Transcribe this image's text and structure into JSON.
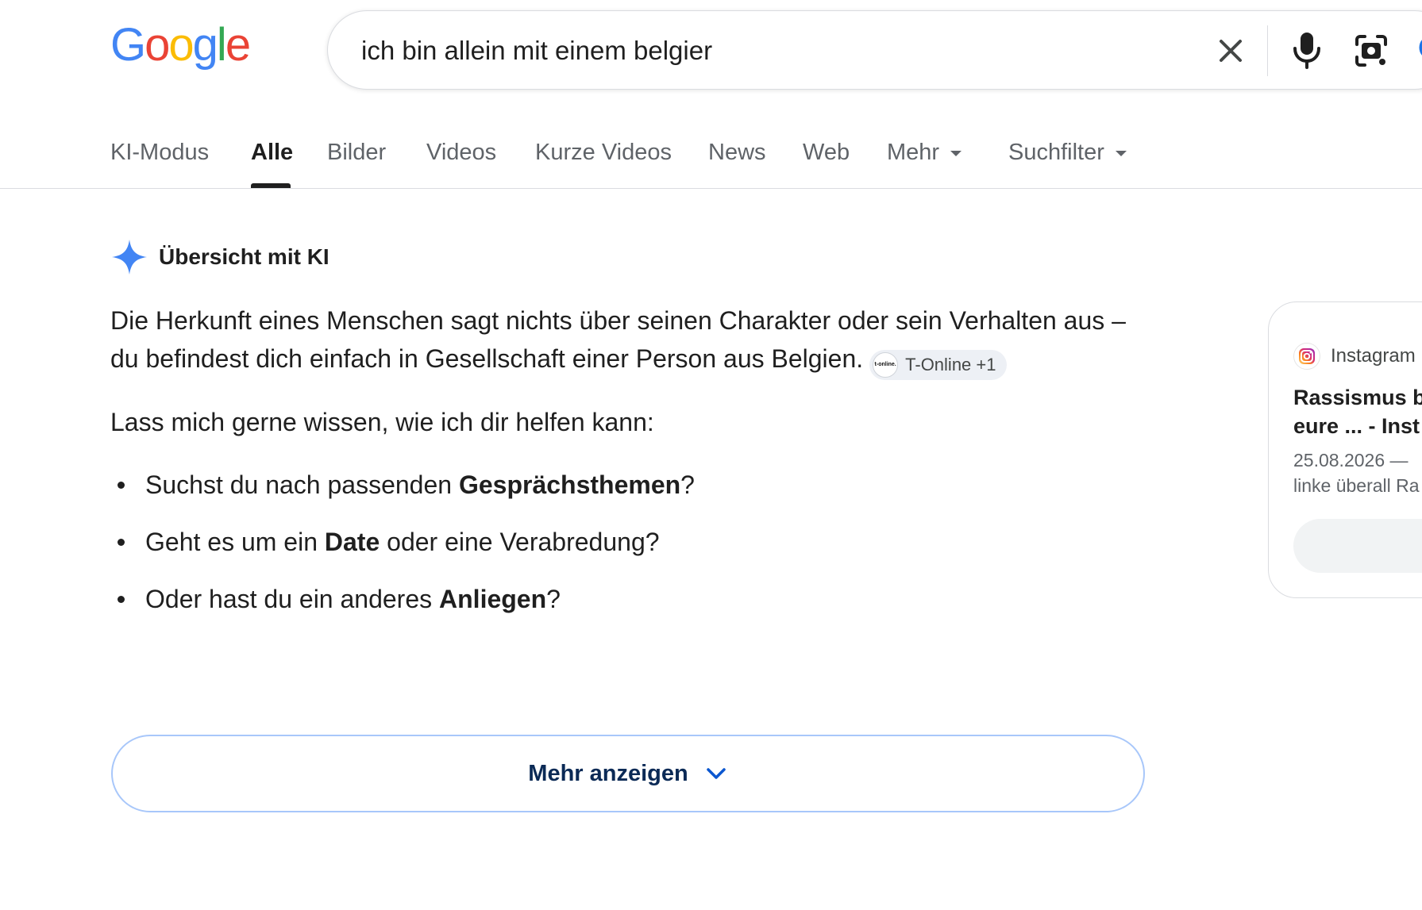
{
  "logo": {
    "letters": [
      "G",
      "o",
      "o",
      "g",
      "l",
      "e"
    ],
    "colors": [
      "#4285F4",
      "#EA4335",
      "#FBBC05",
      "#4285F4",
      "#34A853",
      "#EA4335"
    ]
  },
  "search": {
    "query": "ich bin allein mit einem belgier",
    "icons": [
      "close-icon",
      "mic-icon",
      "lens-icon",
      "search-icon"
    ]
  },
  "tabs": [
    {
      "label": "KI-Modus",
      "active": false
    },
    {
      "label": "Alle",
      "active": true
    },
    {
      "label": "Bilder",
      "active": false
    },
    {
      "label": "Videos",
      "active": false
    },
    {
      "label": "Kurze Videos",
      "active": false
    },
    {
      "label": "News",
      "active": false
    },
    {
      "label": "Web",
      "active": false
    },
    {
      "label": "Mehr",
      "active": false,
      "dropdown": true
    },
    {
      "label": "Suchfilter",
      "active": false,
      "dropdown": true
    }
  ],
  "ai_overview": {
    "title": "Übersicht mit KI",
    "paragraph": "Die Herkunft eines Menschen sagt nichts über seinen Charakter oder sein Verhalten aus – du befindest dich einfach in Gesellschaft einer Person aus Belgien.",
    "source_chip": {
      "logo_text": "t-online.",
      "label": "T-Online +1"
    },
    "lead": "Lass mich gerne wissen, wie ich dir helfen kann:",
    "bullets": [
      {
        "before": "Suchst du nach passenden ",
        "bold": "Gesprächsthemen",
        "after": "?"
      },
      {
        "before": "Geht es um ein ",
        "bold": "Date",
        "after": " oder eine Verabredung?"
      },
      {
        "before": "Oder hast du ein anderes ",
        "bold": "Anliegen",
        "after": "?"
      }
    ],
    "more_button": "Mehr anzeigen"
  },
  "side_card": {
    "source": "Instagram",
    "title_line1": "Rassismus b",
    "title_line2": "eure ... - Inst",
    "date": "25.08.2026 —",
    "snippet": "linke überall Ra"
  },
  "colors": {
    "accent_blue": "#1a73e8",
    "spark_blue": "#4285F4",
    "more_button_border": "#a8c7fa",
    "text_primary": "#1f1f1f",
    "text_secondary": "#5f6368"
  }
}
